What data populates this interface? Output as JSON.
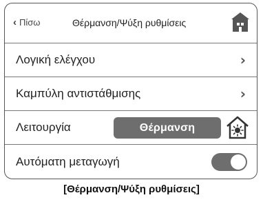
{
  "header": {
    "back_label": "Πίσω",
    "title": "Θέρμανση/Ψύξη ρυθμίσεις"
  },
  "rows": {
    "control_logic": {
      "label": "Λογική ελέγχου"
    },
    "compensation_curve": {
      "label": "Καμπύλη αντιστάθμισης"
    },
    "mode": {
      "label": "Λειτουργία",
      "value": "Θέρμανση"
    },
    "auto_switch": {
      "label": "Αυτόματη μεταγωγή",
      "enabled": true
    }
  },
  "caption": "[Θέρμανση/Ψύξη ρυθμίσεις]",
  "colors": {
    "accent": "#6e6e6e",
    "border": "#555555"
  }
}
